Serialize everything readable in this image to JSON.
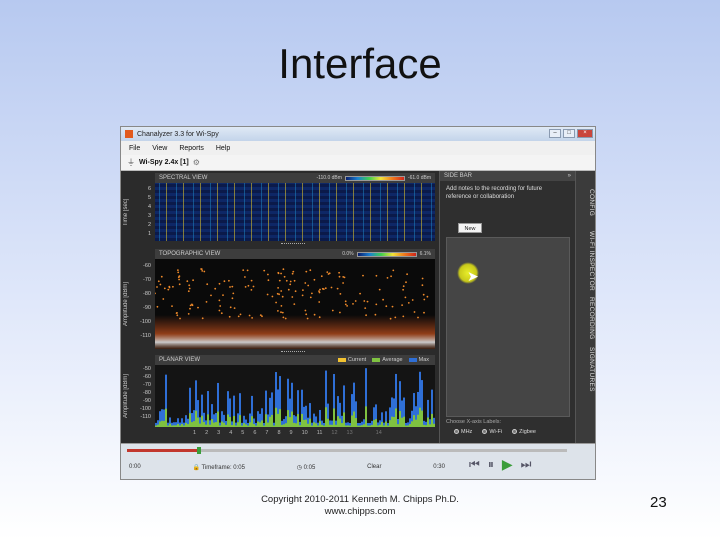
{
  "slide": {
    "title": "Interface",
    "footer_line1": "Copyright 2010-2011 Kenneth M. Chipps Ph.D.",
    "footer_line2": "www.chipps.com",
    "page_number": "23"
  },
  "window": {
    "title": "Chanalyzer 3.3 for Wi-Spy",
    "buttons": [
      "–",
      "□",
      "×"
    ]
  },
  "menu": [
    "File",
    "View",
    "Reports",
    "Help"
  ],
  "device": {
    "name": "Wi-Spy 2.4x [1]"
  },
  "spectral": {
    "header": "SPECTRAL VIEW",
    "scale_min": "-110.0 dBm",
    "scale_max": "-61.0 dBm",
    "axis_label": "Time [sec]",
    "ticks": [
      "6",
      "5",
      "4",
      "3",
      "2",
      "1"
    ]
  },
  "topographic": {
    "header": "TOPOGRAPHIC VIEW",
    "scale_min": "0.0%",
    "scale_max": "6.1%",
    "axis_label": "Amplitude [dBm]",
    "ticks": [
      "-60",
      "-70",
      "-80",
      "-90",
      "-100",
      "-110"
    ]
  },
  "planar": {
    "header": "PLANAR VIEW",
    "axis_label": "Amplitude [dBm]",
    "ticks": [
      "-50",
      "-60",
      "-70",
      "-80",
      "-90",
      "-100",
      "-110"
    ],
    "legend": [
      {
        "label": "Current",
        "color": "#f2c230"
      },
      {
        "label": "Average",
        "color": "#7fc241"
      },
      {
        "label": "Max",
        "color": "#2f6fd6"
      }
    ]
  },
  "channels": [
    "1",
    "2",
    "3",
    "4",
    "5",
    "6",
    "7",
    "8",
    "9",
    "10",
    "11",
    "12",
    "13",
    "14"
  ],
  "sidebar": {
    "header": "SIDE BAR",
    "collapse": "»",
    "note": "Add notes to the recording for future reference or collaboration",
    "new_button": "New",
    "xaxis_label": "Choose X-axis Labels:",
    "xaxis_options": [
      "MHz",
      "Wi-Fi",
      "Zigbee"
    ]
  },
  "tabs": [
    "CONFIG",
    "WI-FI INSPECTOR",
    "RECORDING",
    "SIGNATURES"
  ],
  "timeline": {
    "start": "0:00",
    "timeframe_label": "Timeframe:",
    "timeframe_value": "0:05",
    "elapsed": "0:05",
    "clear": "Clear",
    "end": "0:30",
    "progress": 0.16
  },
  "transport": [
    "⏮",
    "⏸",
    "▶",
    "⏭"
  ]
}
